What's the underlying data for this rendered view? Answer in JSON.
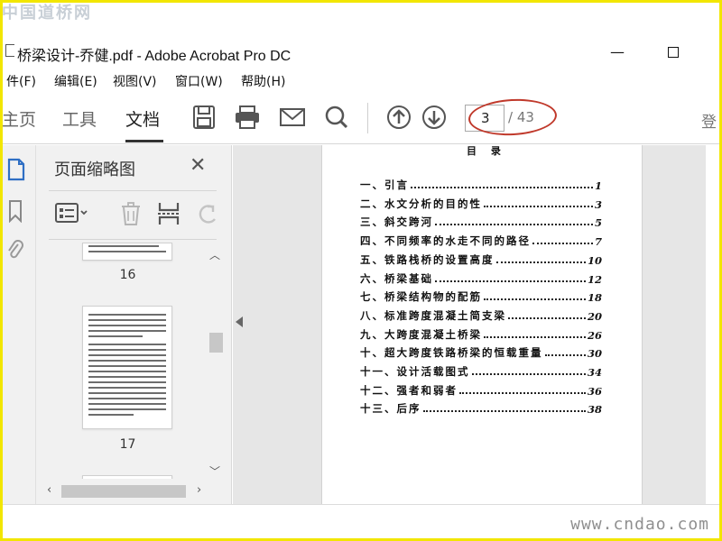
{
  "watermark": {
    "top": "中国道桥网",
    "bottom": "www.cndao.com"
  },
  "window": {
    "title": "桥梁设计-乔健.pdf - Adobe Acrobat Pro DC",
    "minimize": "—"
  },
  "menu": [
    "件(F)",
    "编辑(E)",
    "视图(V)",
    "窗口(W)",
    "帮助(H)"
  ],
  "tabs": [
    {
      "label": "主页",
      "active": false
    },
    {
      "label": "工具",
      "active": false
    },
    {
      "label": "文档",
      "active": true
    }
  ],
  "toolbar": {
    "icons": [
      "save-icon",
      "print-icon",
      "email-icon",
      "search-icon",
      "page-up-icon",
      "page-down-icon"
    ],
    "current_page": "3",
    "total_pages": "/ 43",
    "right_partial": "登",
    "highlight_color": "#c0392b"
  },
  "left_rail": {
    "icons": [
      "page-thumbnails-icon",
      "bookmark-icon",
      "attachment-icon"
    ]
  },
  "thumbnail_panel": {
    "title": "页面缩略图",
    "close_label": "✕",
    "tools": [
      "thumbnail-options-icon",
      "delete-icon",
      "extract-icon",
      "rotate-icon"
    ],
    "pages": [
      {
        "label": "16"
      },
      {
        "label": "17"
      }
    ]
  },
  "document": {
    "heading": "目  录",
    "toc": [
      {
        "title": "一、引言",
        "page": "1"
      },
      {
        "title": "二、水文分析的目的性",
        "page": "3"
      },
      {
        "title": "三、斜交跨河",
        "page": "5"
      },
      {
        "title": "四、不同频率的水走不同的路径",
        "page": "7"
      },
      {
        "title": "五、铁路栈桥的设置高度",
        "page": "10"
      },
      {
        "title": "六、桥梁基础",
        "page": "12"
      },
      {
        "title": "七、桥梁结构物的配筋",
        "page": "18"
      },
      {
        "title": "八、标准跨度混凝土简支梁",
        "page": "20"
      },
      {
        "title": "九、大跨度混凝土桥梁",
        "page": "26"
      },
      {
        "title": "十、超大跨度铁路桥梁的恒载重量",
        "page": "30"
      },
      {
        "title": "十一、设计活载图式",
        "page": "34"
      },
      {
        "title": "十二、强者和弱者",
        "page": "36"
      },
      {
        "title": "十三、后序",
        "page": "38"
      }
    ]
  }
}
